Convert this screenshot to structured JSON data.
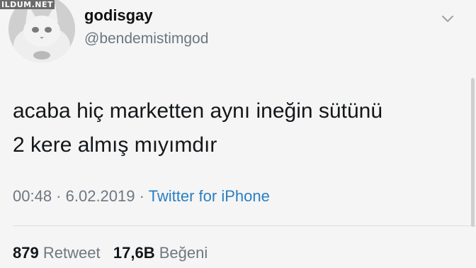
{
  "watermark": "ILDUM.NET",
  "user": {
    "display_name": "godisgay",
    "handle": "@bendemistimgod"
  },
  "tweet": {
    "line1": "acaba hiç marketten aynı ineğin sütünü",
    "line2": "2 kere almış mıyımdır"
  },
  "meta": {
    "time": "00:48",
    "sep1": " · ",
    "date": "6.02.2019",
    "sep2": " · ",
    "source": "Twitter for iPhone"
  },
  "stats": {
    "retweet_count": "879",
    "retweet_label": "Retweet",
    "like_count": "17,6B",
    "like_label": "Beğeni"
  },
  "icons": {
    "menu": "chevron-down-icon",
    "avatar": "cat-avatar"
  },
  "colors": {
    "link": "#2a7fc2",
    "secondary_text": "#6f7780",
    "primary_text": "#14171a"
  }
}
